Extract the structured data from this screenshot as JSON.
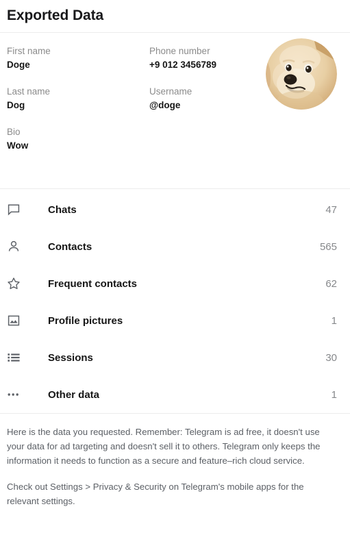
{
  "header": {
    "title": "Exported Data"
  },
  "profile": {
    "fields": [
      {
        "label": "First name",
        "value": "Doge"
      },
      {
        "label": "Phone number",
        "value": "+9 012 3456789"
      },
      {
        "label": "Last name",
        "value": "Dog"
      },
      {
        "label": "Username",
        "value": "@doge"
      },
      {
        "label": "Bio",
        "value": "Wow"
      }
    ],
    "avatar": {
      "icon": "doge-avatar",
      "alt": "Doge profile picture"
    }
  },
  "stats": {
    "rows": [
      {
        "icon": "chat-bubble-icon",
        "label": "Chats",
        "count": "47"
      },
      {
        "icon": "person-icon",
        "label": "Contacts",
        "count": "565"
      },
      {
        "icon": "star-icon",
        "label": "Frequent contacts",
        "count": "62"
      },
      {
        "icon": "image-icon",
        "label": "Profile pictures",
        "count": "1"
      },
      {
        "icon": "list-icon",
        "label": "Sessions",
        "count": "30"
      },
      {
        "icon": "ellipsis-icon",
        "label": "Other data",
        "count": "1"
      }
    ]
  },
  "footer": {
    "paragraphs": [
      "Here is the data you requested. Remember: Telegram is ad free, it doesn't use your data for ad targeting and doesn't sell it to others. Telegram only keeps the information it needs to function as a secure and feature–rich cloud service.",
      "Check out Settings > Privacy & Security on Telegram's mobile apps for the relevant settings."
    ]
  },
  "colors": {
    "text": "#161616",
    "muted": "#8b8b8b",
    "icon": "#5e6268",
    "divider": "#ececec",
    "background": "#ffffff"
  }
}
